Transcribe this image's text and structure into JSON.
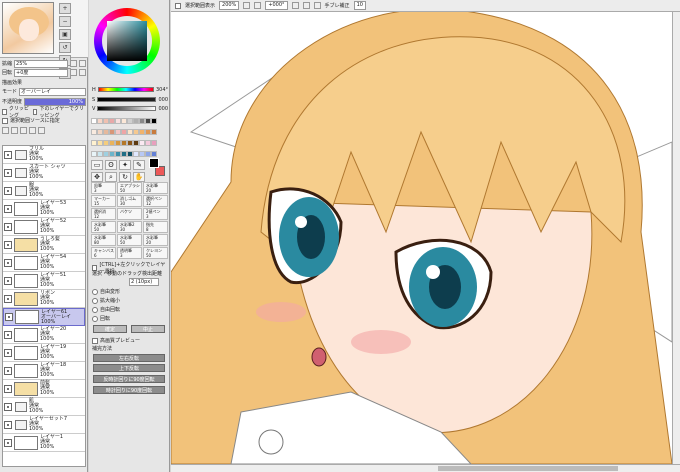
{
  "navigator": {
    "zoom_label": "拡縮",
    "zoom_value": "25%",
    "rotate_label": "回転",
    "rotate_value": "+0度"
  },
  "layer_panel": {
    "section": "描画効果",
    "mode_label": "モード",
    "mode_value": "オーバーレイ",
    "opacity_label": "不透明度",
    "opacity_value": "100%",
    "clip_label": "クリッピング",
    "clip_below_label": "下のレイヤーでクリッピング",
    "sel_source_label": "選択範囲ソースに指定",
    "layers": [
      {
        "name": "フリル",
        "mode": "通常",
        "opacity": "100%",
        "kind": "folder"
      },
      {
        "name": "スカート シャツ",
        "mode": "通常",
        "opacity": "100%",
        "kind": "folder"
      },
      {
        "name": "服",
        "mode": "通常",
        "opacity": "100%",
        "kind": "folder"
      },
      {
        "name": "レイヤー53",
        "mode": "通常",
        "opacity": "100%",
        "kind": "thumb"
      },
      {
        "name": "レイヤー52",
        "mode": "通常",
        "opacity": "100%",
        "kind": "thumb"
      },
      {
        "name": "うしろ髪",
        "mode": "通常",
        "opacity": "100%",
        "kind": "thumb-cream"
      },
      {
        "name": "レイヤー54",
        "mode": "通常",
        "opacity": "100%",
        "kind": "thumb"
      },
      {
        "name": "レイヤー51",
        "mode": "通常",
        "opacity": "100%",
        "kind": "thumb"
      },
      {
        "name": "リボン",
        "mode": "通常",
        "opacity": "100%",
        "kind": "thumb-cream"
      },
      {
        "name": "レイヤー61",
        "mode": "オーバーレイ",
        "opacity": "100%",
        "kind": "thumb",
        "selected": true
      },
      {
        "name": "レイヤー20",
        "mode": "通常",
        "opacity": "100%",
        "kind": "thumb"
      },
      {
        "name": "レイヤー19",
        "mode": "通常",
        "opacity": "100%",
        "kind": "thumb"
      },
      {
        "name": "レイヤー18",
        "mode": "通常",
        "opacity": "100%",
        "kind": "thumb"
      },
      {
        "name": "前髪",
        "mode": "通常",
        "opacity": "100%",
        "kind": "thumb-cream"
      },
      {
        "name": "肌",
        "mode": "通常",
        "opacity": "100%",
        "kind": "folder"
      },
      {
        "name": "レイヤーセット7",
        "mode": "通常",
        "opacity": "100%",
        "kind": "folder"
      },
      {
        "name": "レイヤー1",
        "mode": "通常",
        "opacity": "100%",
        "kind": "thumb"
      }
    ]
  },
  "color": {
    "h_label": "H",
    "h_value": "304°",
    "s_label": "S",
    "s_value": "000",
    "v_label": "V",
    "v_value": "000",
    "fg": "#000000",
    "bg": "#ec5858",
    "palette": [
      "#ffffff",
      "#f7d6c8",
      "#f0c0b0",
      "#e8a8a8",
      "#f8e0e0",
      "#fce8d8",
      "#d0d0d0",
      "#b0b0b0",
      "#888888",
      "#444444",
      "#000000",
      "#f9ebe0",
      "#f2d5c3",
      "#e6b99c",
      "#d89678",
      "#f4c7c7",
      "#efa5a5",
      "#fde4c8",
      "#f6c98f",
      "#f1b36b",
      "#e09955",
      "#c87b3d",
      "#fff2d0",
      "#fbe2a6",
      "#f4cd7d",
      "#e9b35a",
      "#d6973c",
      "#b47728",
      "#8a5619",
      "#5d3a10",
      "#fbe9f2",
      "#f5c9dc",
      "#e89fbd",
      "#e8f4f8",
      "#c9e6ef",
      "#9fd0e0",
      "#6bb5cb",
      "#3b8fa9",
      "#1f6e86",
      "#114f63",
      "#e0e8ff",
      "#b8c8f5",
      "#8ea6e8",
      "#6480d5"
    ]
  },
  "tools": {
    "icons": [
      "select-rect",
      "lasso",
      "magic-wand",
      "eyedropper",
      "move",
      "zoom",
      "rotate",
      "hand"
    ],
    "brushes": [
      {
        "name": "鉛筆",
        "size": "3"
      },
      {
        "name": "エアブラシ",
        "size": "50"
      },
      {
        "name": "水彩筆",
        "size": "20"
      },
      {
        "name": "マーカー",
        "size": "15"
      },
      {
        "name": "消しゴム",
        "size": "30"
      },
      {
        "name": "選択ペン",
        "size": "12"
      },
      {
        "name": "選択消",
        "size": "12"
      },
      {
        "name": "バケツ",
        "size": ""
      },
      {
        "name": "2値ペン",
        "size": "3"
      },
      {
        "name": "水彩筆",
        "size": "50"
      },
      {
        "name": "水彩筆2",
        "size": "30"
      },
      {
        "name": "指先",
        "size": "8"
      },
      {
        "name": "水彩筆",
        "size": "80"
      },
      {
        "name": "水彩筆",
        "size": "50"
      },
      {
        "name": "水彩筆",
        "size": "20"
      },
      {
        "name": "キャンバス",
        "size": "6"
      },
      {
        "name": "透明筆",
        "size": "3"
      },
      {
        "name": "クレヨン",
        "size": "50"
      }
    ],
    "opt_ctrl_drag": "[CTRL]+左クリックでレイヤー選択",
    "opt_handle_label": "選択・移動のドラッグ検出距離",
    "opt_handle_value": "2 (10px)",
    "radio_free": "自由変形",
    "radio_scale": "拡大縮小",
    "radio_rotate": "自由回転",
    "radio_distort": "回転",
    "btn_ok": "確定",
    "btn_cancel": "中止",
    "opt_preview": "高画質プレビュー",
    "interp_label": "補完方法",
    "btn_flip_h": "左右反転",
    "btn_flip_v": "上下反転",
    "btn_rot_ccw": "反時計回りに90度回転",
    "btn_rot_cw": "時計回りに90度回転"
  },
  "topbar": {
    "sel_border_label": "選択範囲表示",
    "zoom": "200%",
    "rotation": "+000°",
    "stabilizer_label": "手ブレ補正",
    "stabilizer": "10"
  }
}
